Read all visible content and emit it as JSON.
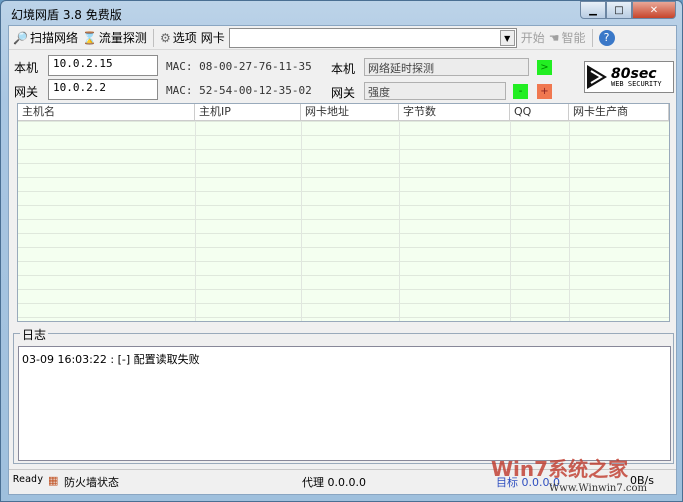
{
  "window": {
    "title": "幻境网盾 3.8 免费版"
  },
  "toolbar": {
    "scan": "扫描网络",
    "traffic": "流量探测",
    "options": "选项",
    "nic_label": "网卡",
    "nic_value": "",
    "start": "开始",
    "smart": "智能"
  },
  "local": {
    "label": "本机",
    "ip": "10.0.2.15",
    "mac": "MAC: 08-00-27-76-11-35"
  },
  "gateway": {
    "label": "网关",
    "ip": "10.0.2.2",
    "mac": "MAC: 52-54-00-12-35-02"
  },
  "probe": {
    "local_label": "本机",
    "local_value": "网络延时探测",
    "gw_label": "网关",
    "gw_value": "强度",
    "go": ">",
    "minus": "-",
    "plus": "+"
  },
  "logo": {
    "text": "80sec",
    "sub": "WEB SECURITY"
  },
  "table": {
    "columns": [
      "主机名",
      "主机IP",
      "网卡地址",
      "字节数",
      "QQ",
      "网卡生产商"
    ],
    "rows": []
  },
  "log": {
    "title": "日志",
    "lines": [
      "03-09 16:03:22 : [-] 配置读取失败"
    ]
  },
  "status": {
    "ready": "Ready",
    "firewall": "防火墙状态",
    "proxy": "代理 0.0.0.0",
    "target": "目标 0.0.0.0",
    "rate": "0B/s"
  },
  "watermark": {
    "brand": "Win7系统之家",
    "url": "Www.Winwin7.com"
  }
}
